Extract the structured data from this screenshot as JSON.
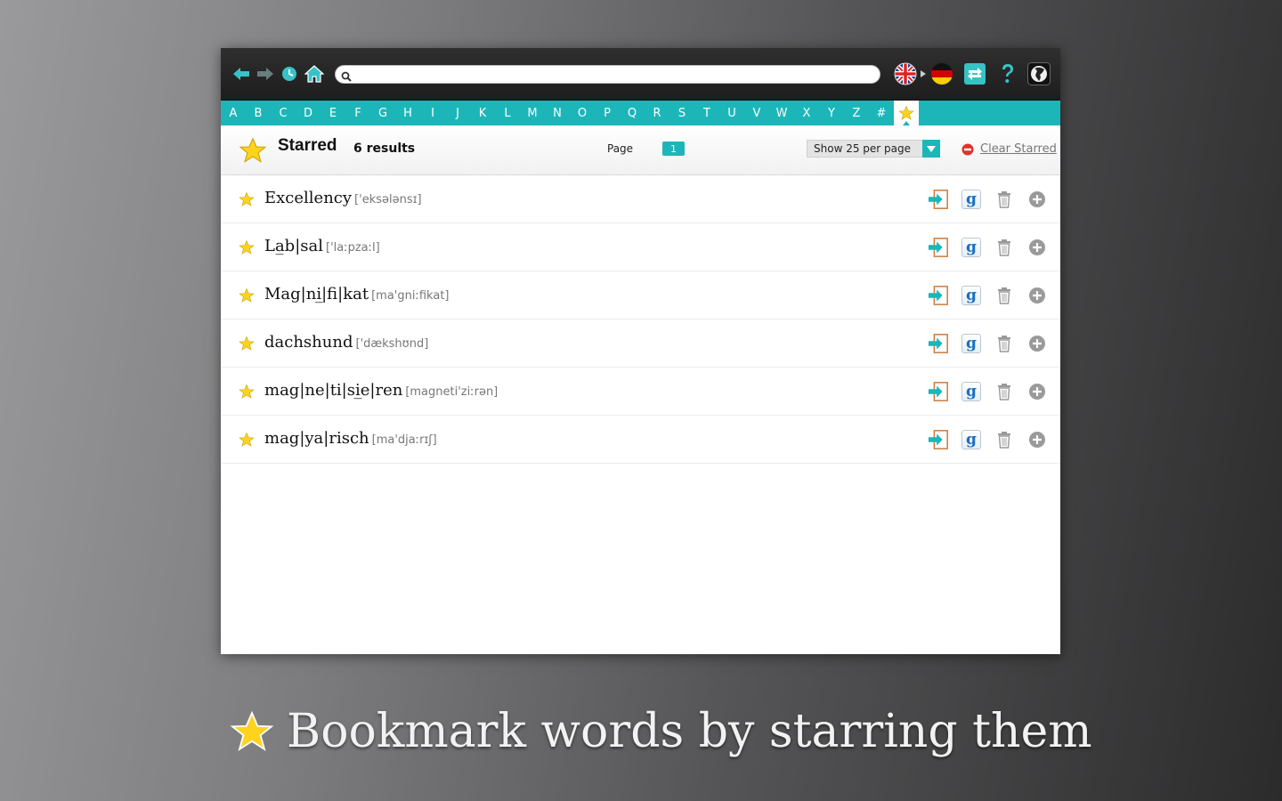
{
  "toolbar": {
    "search_value": "",
    "search_placeholder": "",
    "colors": {
      "accent": "#1cb6b9",
      "toolbar_bg": "#262626"
    }
  },
  "letters": [
    "A",
    "B",
    "C",
    "D",
    "E",
    "F",
    "G",
    "H",
    "I",
    "J",
    "K",
    "L",
    "M",
    "N",
    "O",
    "P",
    "Q",
    "R",
    "S",
    "T",
    "U",
    "V",
    "W",
    "X",
    "Y",
    "Z",
    "#"
  ],
  "header": {
    "title": "Starred",
    "count": "6 results",
    "page_label": "Page",
    "page_number": "1",
    "per_page": "Show 25 per page",
    "clear_label": "Clear Starred"
  },
  "entries": [
    {
      "word": "Excellency",
      "ipa": "['eksələnsɪ]"
    },
    {
      "word": "La̲b|sal",
      "ipa": "['laːpzaːl]"
    },
    {
      "word": "Mag|ni̲|fi|kat",
      "ipa": "[ma'gniːfikat]"
    },
    {
      "word": "dachshund",
      "ipa": "['dækshʊnd]"
    },
    {
      "word": "mag|ne|ti|si̲e|ren",
      "ipa": "[magneti'ziːrən]"
    },
    {
      "word": "mag|ya|risch",
      "ipa": "[ma'djaːrɪʃ]"
    }
  ],
  "caption": "Bookmark words by starring them"
}
